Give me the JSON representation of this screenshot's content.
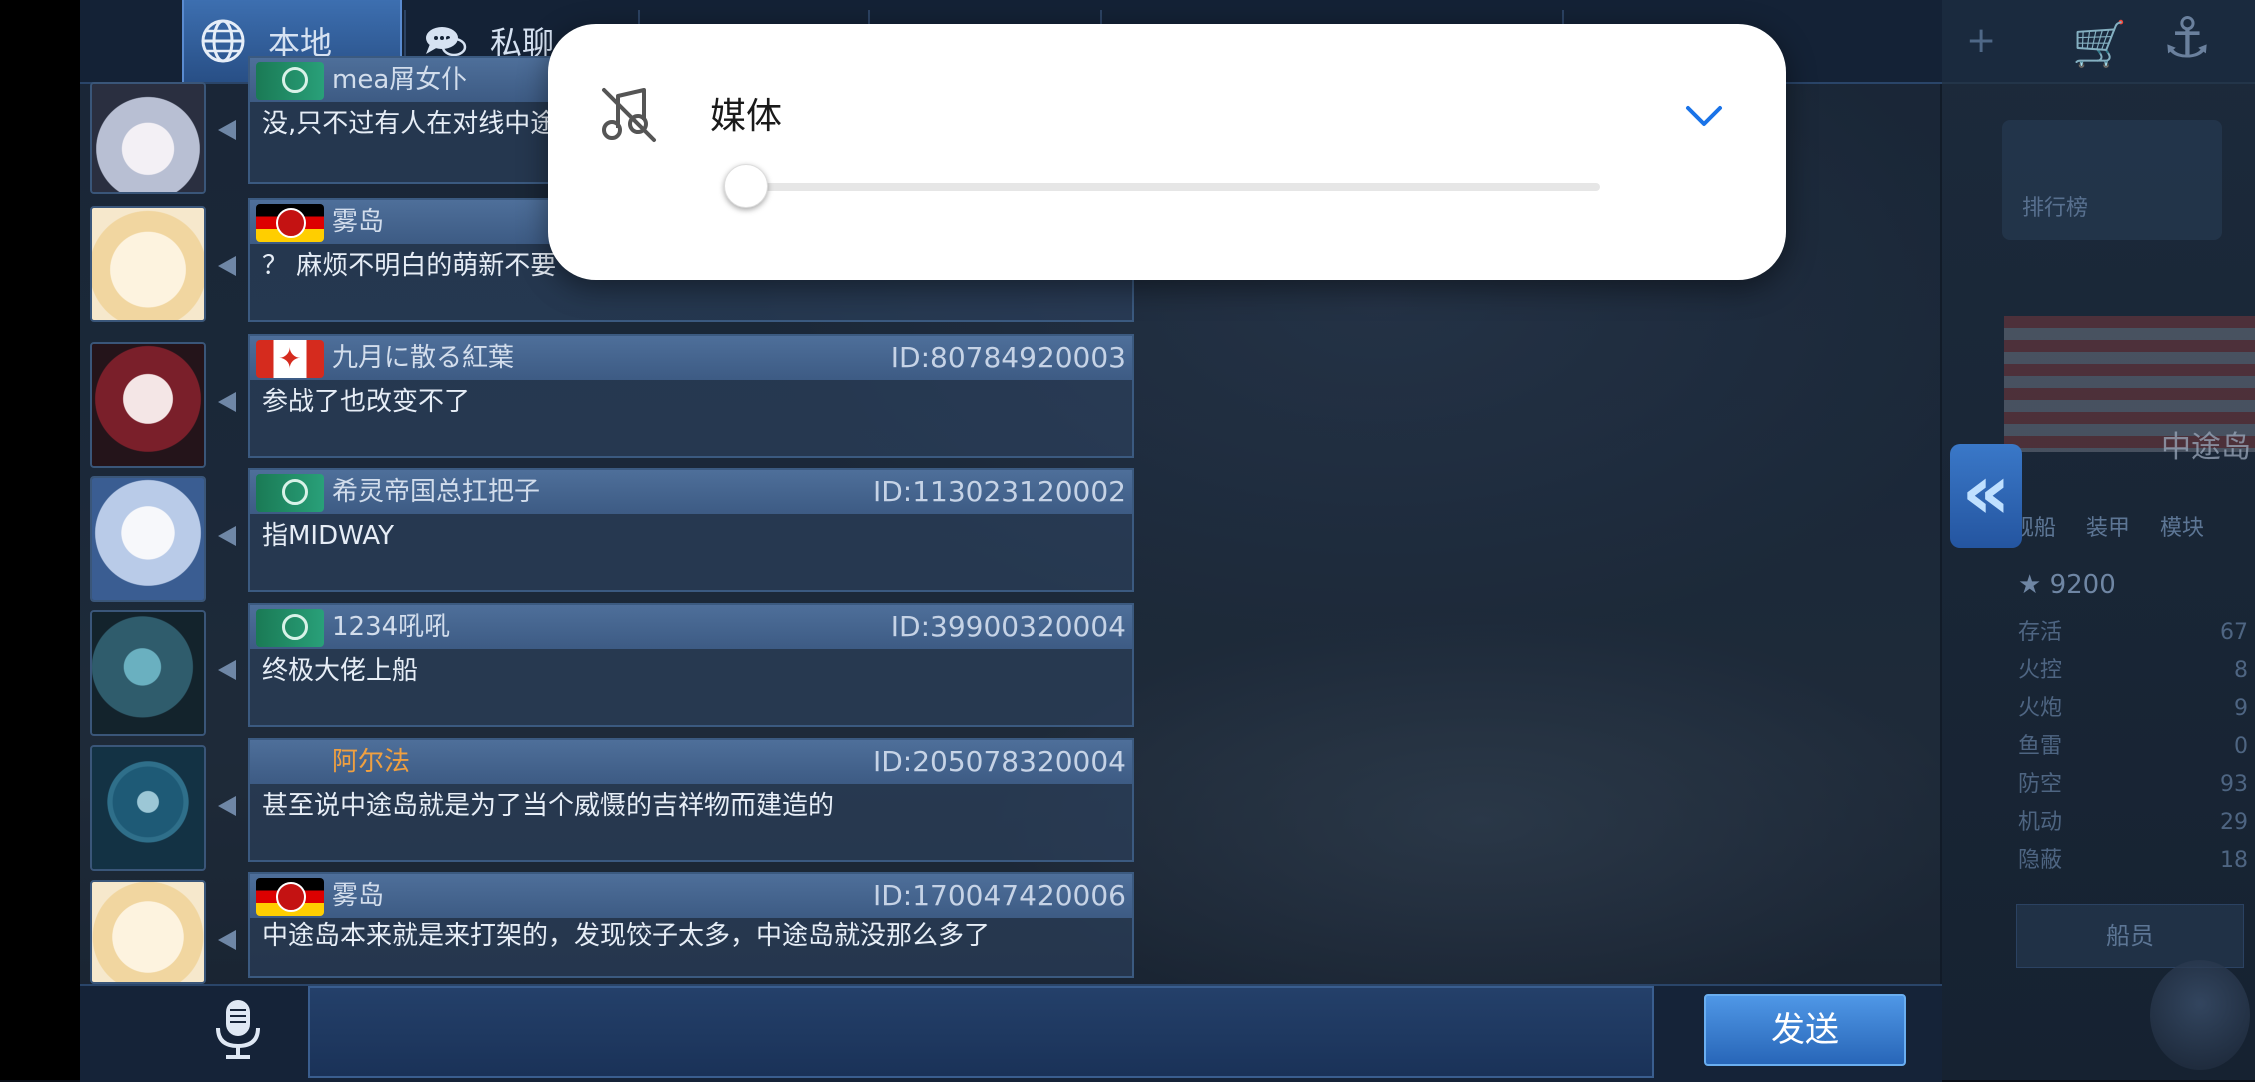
{
  "tabs": {
    "local": "本地",
    "private": "私聊"
  },
  "messages": [
    {
      "name": "mea屑女仆",
      "id": "",
      "text": "没,只不过有人在对线中途",
      "flag": "green",
      "avatar_color": "#d8dbe6"
    },
    {
      "name": "雾岛",
      "id": "",
      "text": "？ 麻烦不明白的萌新不要",
      "flag": "de",
      "avatar_color": "#f3e2c0"
    },
    {
      "name": "九月に散る紅葉",
      "id": "ID:80784920003",
      "text": "参战了也改变不了",
      "flag": "ca",
      "avatar_color": "#5a1f25"
    },
    {
      "name": "希灵帝国总扛把子",
      "id": "ID:113023120002",
      "text": "指MIDWAY",
      "flag": "green",
      "avatar_color": "#c9d8ef"
    },
    {
      "name": "1234吼吼",
      "id": "ID:39900320004",
      "text": "终极大佬上船",
      "flag": "green",
      "avatar_color": "#2e5a6e"
    },
    {
      "name": "阿尔法",
      "id": "ID:205078320004",
      "text": "甚至说中途岛就是为了当个威慑的吉祥物而建造的",
      "flag": "none",
      "avatar_color": "#1f4f6b"
    },
    {
      "name": "雾岛",
      "id": "ID:170047420006",
      "text": "中途岛本来就是来打架的，发现饺子太多，中途岛就没那么多了",
      "flag": "de",
      "avatar_color": "#f3e2c0"
    }
  ],
  "input": {
    "placeholder": "",
    "send_label": "发送"
  },
  "volume_panel": {
    "label": "媒体",
    "level": 0,
    "accent_color": "#1a73e8"
  },
  "right_panel": {
    "rank_label": "排行榜",
    "ship_name": "中途岛",
    "tabs": [
      "舰船",
      "装甲",
      "模块"
    ],
    "score": "9200",
    "stats": [
      {
        "label": "存活",
        "value": "67"
      },
      {
        "label": "火控",
        "value": "8"
      },
      {
        "label": "火炮",
        "value": "9"
      },
      {
        "label": "鱼雷",
        "value": "0"
      },
      {
        "label": "防空",
        "value": "93"
      },
      {
        "label": "机动",
        "value": "29"
      },
      {
        "label": "隐蔽",
        "value": "18"
      }
    ],
    "crew_label": "船员"
  }
}
